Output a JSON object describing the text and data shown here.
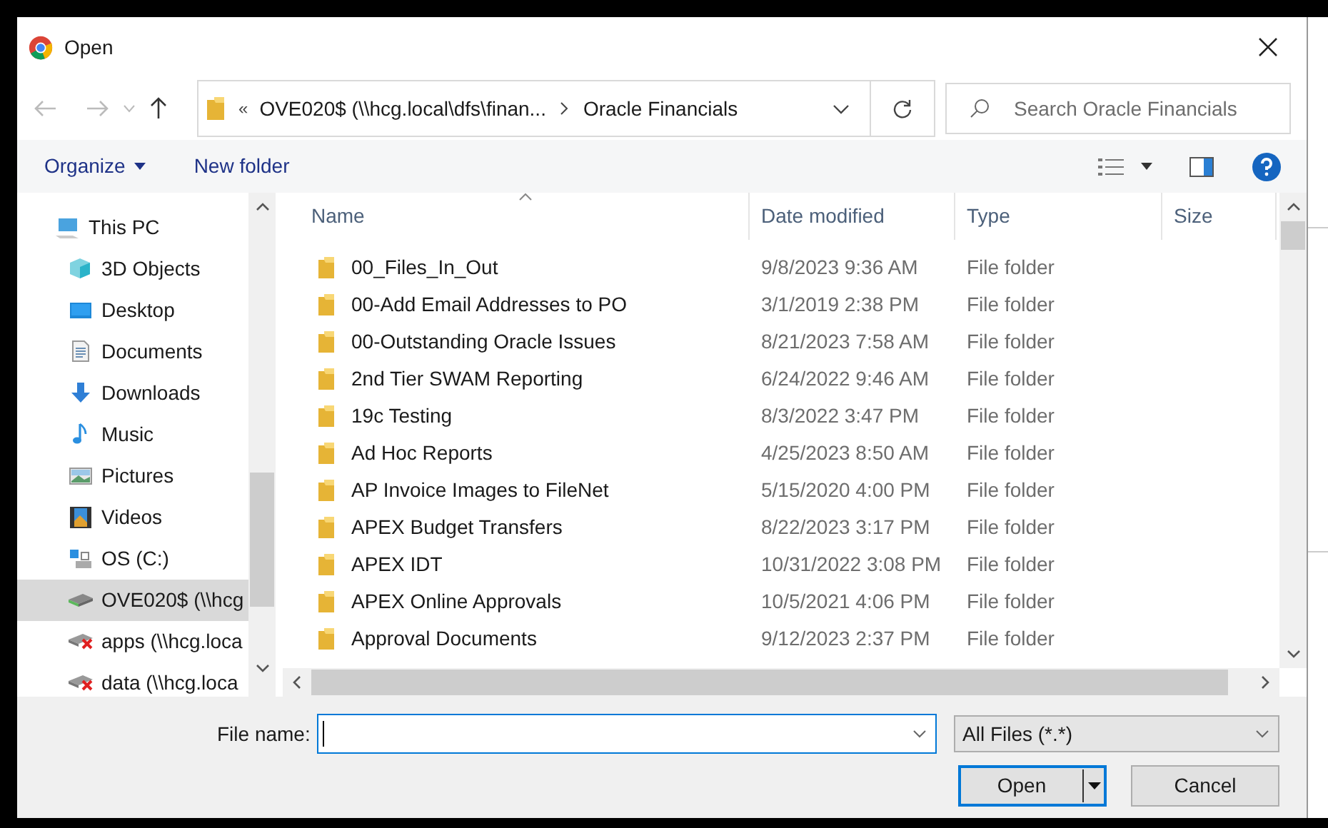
{
  "window": {
    "title": "Open"
  },
  "address": {
    "overflow": "«",
    "segments": [
      "OVE020$ (\\\\hcg.local\\dfs\\finan...",
      "Oracle Financials"
    ]
  },
  "search": {
    "placeholder": "Search Oracle Financials"
  },
  "toolbar": {
    "items": [
      "Organize",
      "New folder"
    ]
  },
  "nav_pane": {
    "items": [
      {
        "label": "This PC",
        "kind": "pc",
        "selected": false,
        "children": [
          {
            "label": "3D Objects",
            "kind": "objects",
            "selected": false
          },
          {
            "label": "Desktop",
            "kind": "desktop",
            "selected": false
          },
          {
            "label": "Documents",
            "kind": "documents",
            "selected": false
          },
          {
            "label": "Downloads",
            "kind": "downloads",
            "selected": false
          },
          {
            "label": "Music",
            "kind": "music",
            "selected": false
          },
          {
            "label": "Pictures",
            "kind": "pictures",
            "selected": false
          },
          {
            "label": "Videos",
            "kind": "videos",
            "selected": false
          },
          {
            "label": "OS (C:)",
            "kind": "os",
            "selected": false
          },
          {
            "label": "OVE020$ (\\\\hcg",
            "kind": "network",
            "selected": true
          },
          {
            "label": "apps (\\\\hcg.loca",
            "kind": "disconnected",
            "selected": false
          },
          {
            "label": "data (\\\\hcg.loca",
            "kind": "disconnected",
            "selected": false
          }
        ]
      }
    ]
  },
  "table": {
    "columns": [
      "Name",
      "Date modified",
      "Type",
      "Size"
    ],
    "rows": [
      {
        "name": "00_Files_In_Out",
        "date": "9/8/2023 9:36 AM",
        "type": "File folder"
      },
      {
        "name": "00-Add Email Addresses to PO",
        "date": "3/1/2019 2:38 PM",
        "type": "File folder"
      },
      {
        "name": "00-Outstanding Oracle Issues",
        "date": "8/21/2023 7:58 AM",
        "type": "File folder"
      },
      {
        "name": "2nd Tier SWAM Reporting",
        "date": "6/24/2022 9:46 AM",
        "type": "File folder"
      },
      {
        "name": "19c Testing",
        "date": "8/3/2022 3:47 PM",
        "type": "File folder"
      },
      {
        "name": "Ad Hoc Reports",
        "date": "4/25/2023 8:50 AM",
        "type": "File folder"
      },
      {
        "name": "AP Invoice Images to FileNet",
        "date": "5/15/2020 4:00 PM",
        "type": "File folder"
      },
      {
        "name": "APEX Budget Transfers",
        "date": "8/22/2023 3:17 PM",
        "type": "File folder"
      },
      {
        "name": "APEX IDT",
        "date": "10/31/2022 3:08 PM",
        "type": "File folder"
      },
      {
        "name": "APEX Online Approvals",
        "date": "10/5/2021 4:06 PM",
        "type": "File folder"
      },
      {
        "name": "Approval Documents",
        "date": "9/12/2023 2:37 PM",
        "type": "File folder"
      }
    ]
  },
  "file_name": {
    "label": "File name:"
  },
  "file_type": {
    "value": "All Files (*.*)"
  },
  "buttons": {
    "open": "Open",
    "cancel": "Cancel"
  }
}
